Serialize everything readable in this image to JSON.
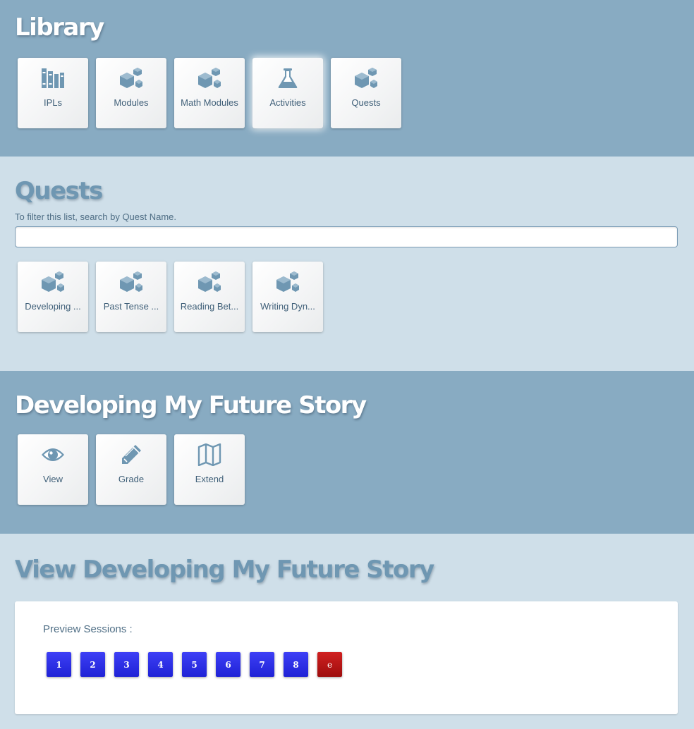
{
  "library": {
    "title": "Library",
    "tiles": [
      {
        "label": "IPLs",
        "icon": "books-icon"
      },
      {
        "label": "Modules",
        "icon": "cubes-icon"
      },
      {
        "label": "Math Modules",
        "icon": "cubes-icon"
      },
      {
        "label": "Activities",
        "icon": "flask-icon"
      },
      {
        "label": "Quests",
        "icon": "cubes-icon"
      }
    ]
  },
  "quests": {
    "title": "Quests",
    "filter_label": "To filter this list, search by Quest Name.",
    "filter_value": "",
    "tiles": [
      {
        "label": "Developing ...",
        "icon": "cubes-icon"
      },
      {
        "label": "Past Tense ...",
        "icon": "cubes-icon"
      },
      {
        "label": "Reading Bet...",
        "icon": "cubes-icon"
      },
      {
        "label": "Writing Dyn...",
        "icon": "cubes-icon"
      }
    ]
  },
  "story": {
    "title": "Developing My Future Story",
    "tiles": [
      {
        "label": "View",
        "icon": "eye-icon"
      },
      {
        "label": "Grade",
        "icon": "pencil-icon"
      },
      {
        "label": "Extend",
        "icon": "map-icon"
      }
    ]
  },
  "view": {
    "title": "View Developing My Future Story",
    "preview_label": "Preview Sessions :",
    "sessions": [
      "1",
      "2",
      "3",
      "4",
      "5",
      "6",
      "7",
      "8",
      "e"
    ]
  },
  "colors": {
    "dark_band": "#88abc2",
    "light_band": "#cfdfe9",
    "icon": "#6f97b2",
    "session_blue": "#2a2de6",
    "session_red": "#b81515"
  }
}
